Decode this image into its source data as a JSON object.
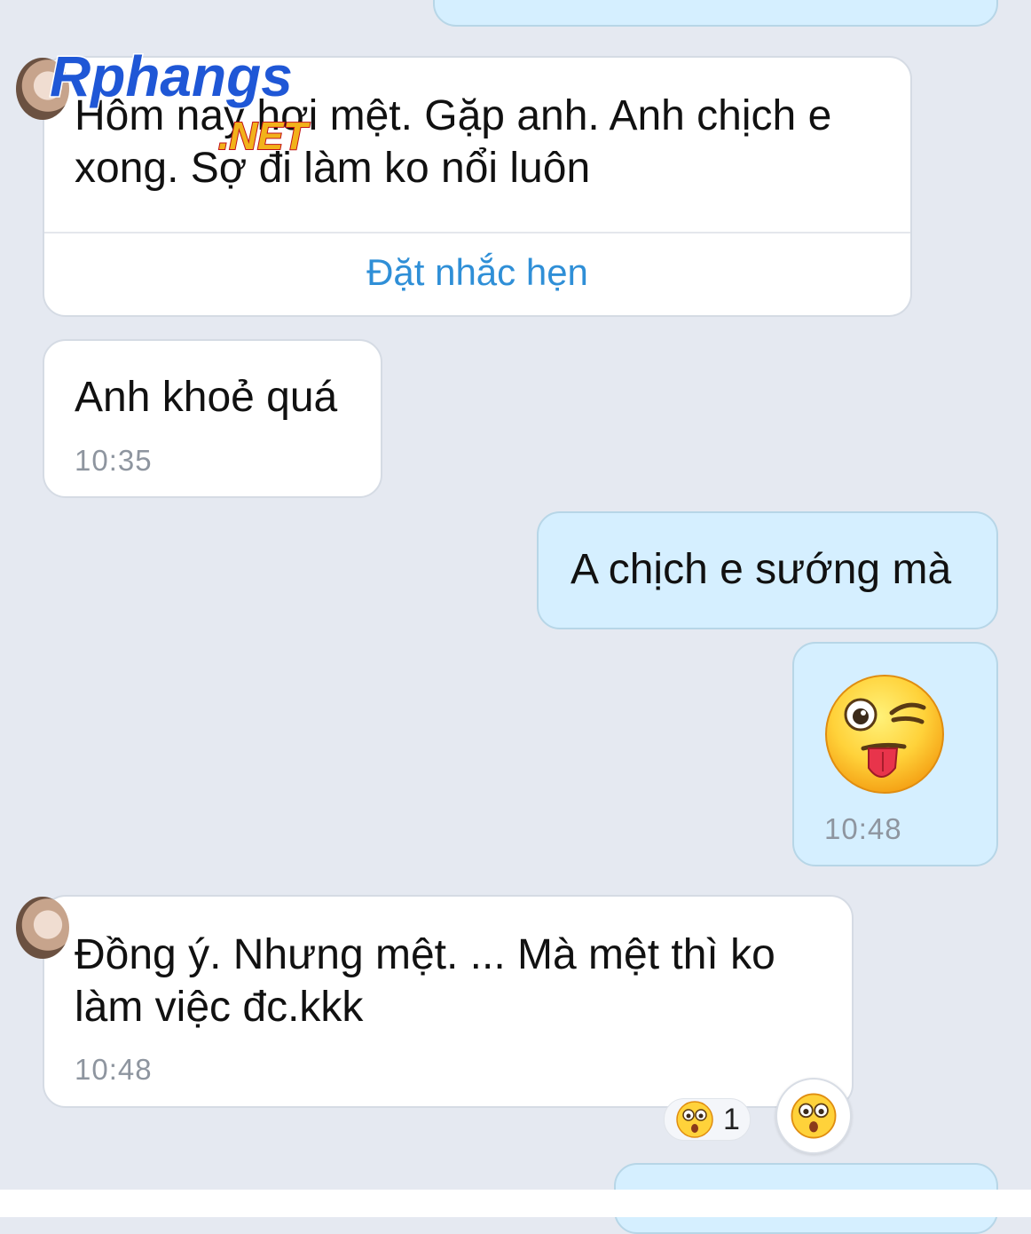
{
  "watermark": {
    "brand": "Rphangs",
    "suffix": ".NET"
  },
  "messages": [
    {
      "text": "Hôm nay hơi mệt. Gặp anh. Anh chịch e\nxong. Sợ đi làm ko nổi luôn",
      "action_label": "Đặt nhắc hẹn"
    },
    {
      "text": "Anh khoẻ quá",
      "time": "10:35"
    },
    {
      "text": "A chịch e sướng mà"
    },
    {
      "sticker": "wink-tongue-emoji",
      "time": "10:48"
    },
    {
      "text": "Đồng ý. Nhưng mệt. ... Mà mệt thì ko\nlàm việc đc.kkk",
      "time": "10:48"
    }
  ],
  "reaction": {
    "icon": "shocked-face-emoji",
    "count": "1"
  },
  "colors": {
    "background": "#e5e9f1",
    "received_bubble": "#ffffff",
    "sent_bubble": "#d5efff",
    "link_blue": "#2f8fd7",
    "timestamp_gray": "#8e959f"
  }
}
